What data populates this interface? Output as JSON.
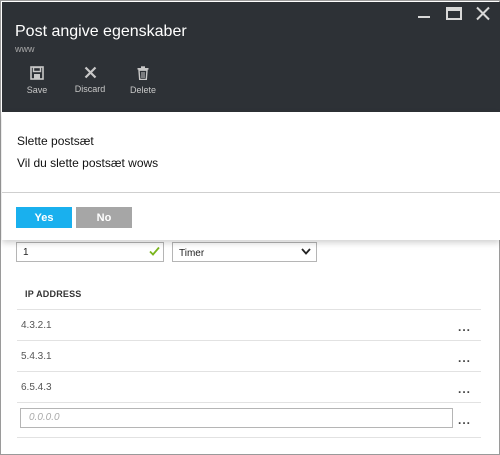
{
  "header": {
    "title": "Post angive egenskaber",
    "subtitle": "www",
    "toolbar": [
      {
        "label": "Save",
        "icon": "save-icon"
      },
      {
        "label": "Discard",
        "icon": "discard-icon"
      },
      {
        "label": "Delete",
        "icon": "delete-icon"
      }
    ]
  },
  "dialog": {
    "title": "Slette postsæt",
    "message": "Vil du slette postsæt wows",
    "yes_label": "Yes",
    "no_label": "No"
  },
  "ttl": {
    "value": "1",
    "unit": "Timer"
  },
  "ip_section": {
    "header": "IP ADDRESS",
    "rows": [
      "4.3.2.1",
      "5.4.3.1",
      "6.5.4.3"
    ],
    "new_placeholder": "0.0.0.0",
    "more_label": "..."
  },
  "colors": {
    "header_bg": "#2d3136",
    "yes_button": "#19b0ee",
    "no_button": "#a6a6a6",
    "check_green": "#7ab51d"
  }
}
